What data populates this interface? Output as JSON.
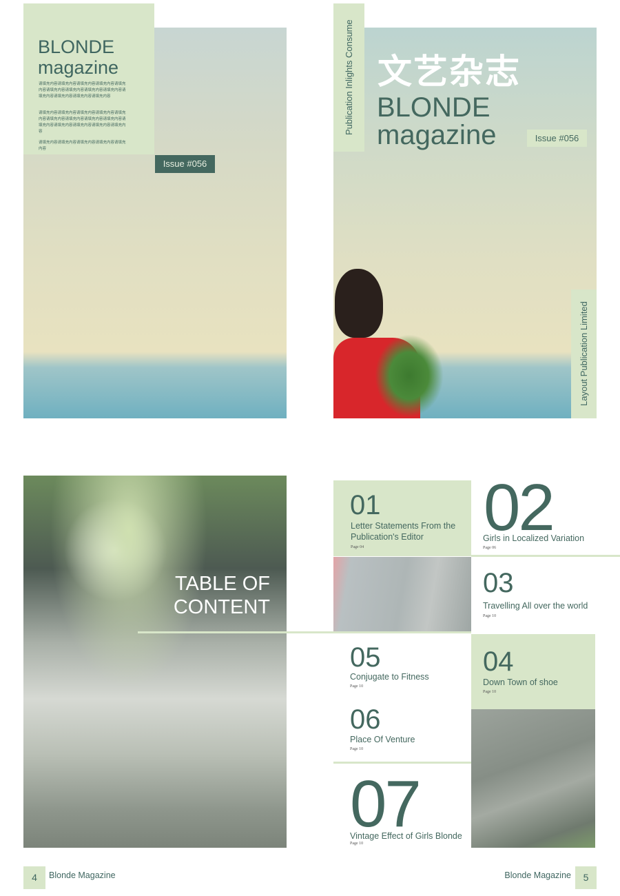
{
  "cover": {
    "title_line1": "BLONDE",
    "title_line2": "magazine",
    "filler_paragraphs": [
      "请填充内容请填充内容请填充内容请填充内容请填充内容请填充内容请填充内容请填充内容请填充内容请填充内容请填充内容请填充内容请填充内容",
      "请填充内容请填充内容请填充内容请填充内容请填充内容请填充内容请填充内容请填充内容请填充内容请填充内容请填充内容请填充内容请填充内容请填充内容",
      "请填充内容请填充内容请填充内容请填充内容请填充内容"
    ],
    "issue": "Issue #056"
  },
  "cover2": {
    "chinese_title": "文艺杂志",
    "title_line1": "BLONDE",
    "title_line2": "magazine",
    "issue": "Issue #056",
    "side_text_left": "Publication Inlights Consume",
    "side_text_right": "Layout Publication Limited"
  },
  "toc": {
    "heading_line1": "TABLE OF",
    "heading_line2": "CONTENT",
    "items": [
      {
        "num": "01",
        "title": "Letter Statements From the Publication's Editor",
        "page": "Page 04"
      },
      {
        "num": "02",
        "title": "Girls in Localized Variation",
        "page": "Page 06"
      },
      {
        "num": "03",
        "title": "Travelling All over the world",
        "page": "Page 10"
      },
      {
        "num": "04",
        "title": "Down Town of shoe",
        "page": "Page 10"
      },
      {
        "num": "05",
        "title": "Conjugate to Fitness",
        "page": "Page 10"
      },
      {
        "num": "06",
        "title": "Place Of Venture",
        "page": "Page 10"
      },
      {
        "num": "07",
        "title": "Vintage Effect of Girls Blonde",
        "page": "Page 10"
      }
    ]
  },
  "footer": {
    "left_page": "4",
    "left_label": "Blonde Magazine",
    "right_label": "Blonde Magazine",
    "right_page": "5"
  },
  "colors": {
    "dark_green": "#44685f",
    "light_green": "#d8e6c9"
  }
}
